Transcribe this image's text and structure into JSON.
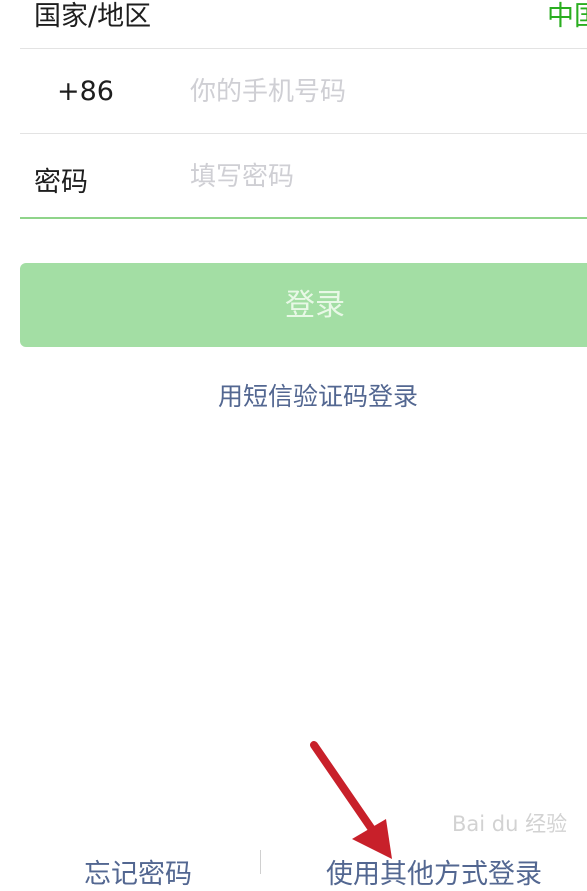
{
  "region": {
    "label": "国家/地区",
    "value": "中国"
  },
  "phone": {
    "prefix": "+86",
    "placeholder": "你的手机号码"
  },
  "password": {
    "label": "密码",
    "placeholder": "填写密码"
  },
  "login_button": "登录",
  "sms_login": "用短信验证码登录",
  "footer": {
    "forgot_password": "忘记密码",
    "other_login": "使用其他方式登录"
  },
  "watermark": "Bai du 经验",
  "colors": {
    "accent": "#2aae20",
    "button": "#a3dea4",
    "link": "#536791",
    "arrow": "#c8202a"
  }
}
